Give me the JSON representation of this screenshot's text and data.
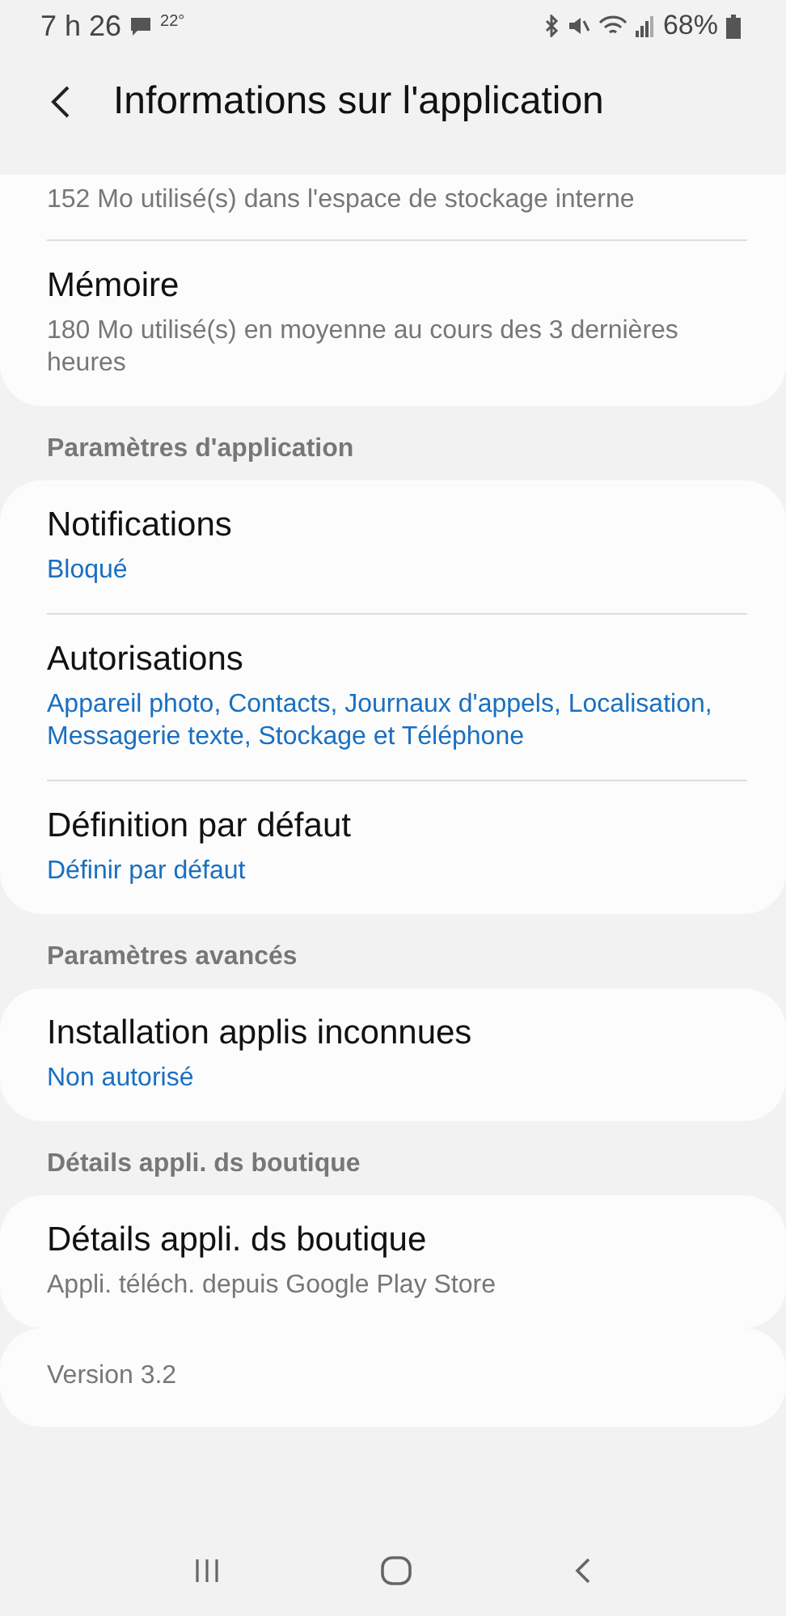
{
  "status_bar": {
    "time": "7 h 26",
    "temperature": "22°",
    "battery": "68%"
  },
  "header": {
    "title": "Informations sur l'application"
  },
  "sections": [
    {
      "items": [
        {
          "kind": "info",
          "subtitle": "152 Mo utilisé(s) dans l'espace de stockage interne"
        },
        {
          "kind": "info",
          "title": "Mémoire",
          "subtitle": "180 Mo utilisé(s) en moyenne au cours des 3 dernières heures"
        }
      ]
    },
    {
      "header": "Paramètres d'application",
      "items": [
        {
          "kind": "link",
          "title": "Notifications",
          "subtitle": "Bloqué"
        },
        {
          "kind": "link",
          "title": "Autorisations",
          "subtitle": "Appareil photo, Contacts, Journaux d'appels, Localisation, Messagerie texte, Stockage et Téléphone"
        },
        {
          "kind": "link",
          "title": "Définition par défaut",
          "subtitle": "Définir par défaut"
        }
      ]
    },
    {
      "header": "Paramètres avancés",
      "items": [
        {
          "kind": "link",
          "title": "Installation applis inconnues",
          "subtitle": "Non autorisé"
        }
      ]
    },
    {
      "header": "Détails appli. ds boutique",
      "items": [
        {
          "kind": "info",
          "title": "Détails appli. ds boutique",
          "subtitle": "Appli. téléch. depuis Google Play Store"
        }
      ]
    },
    {
      "items": [
        {
          "kind": "info",
          "subtitle": "Version 3.2"
        }
      ]
    }
  ]
}
